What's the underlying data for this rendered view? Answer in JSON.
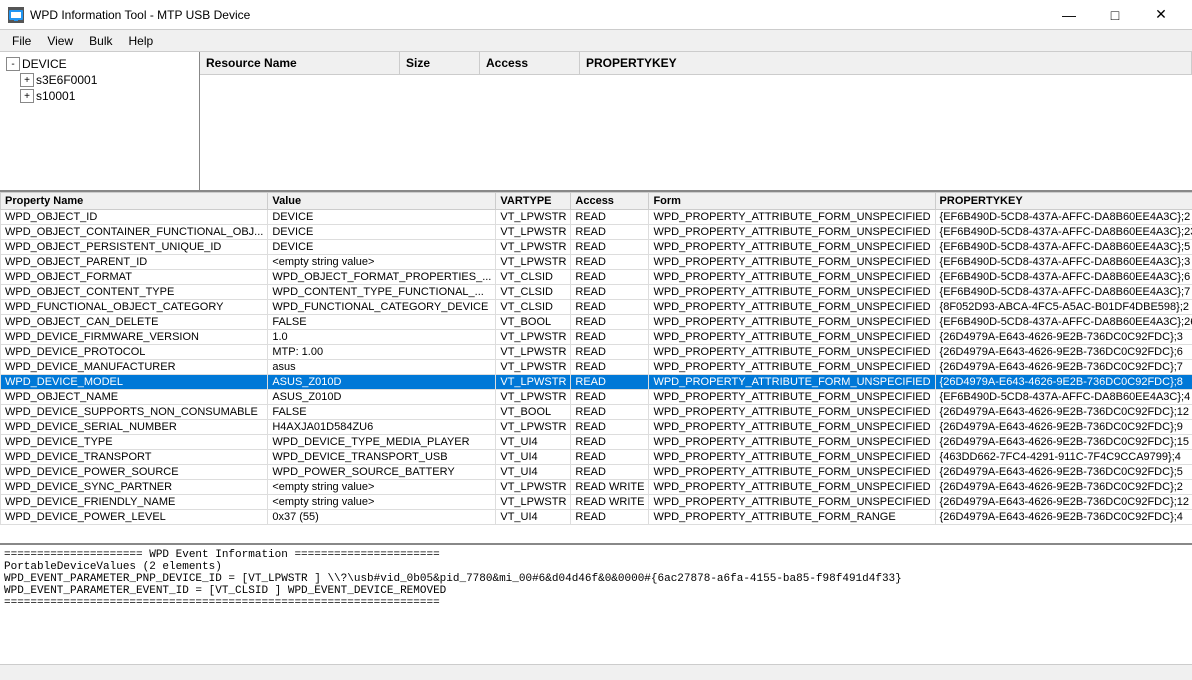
{
  "window": {
    "title": "WPD Information Tool - MTP USB Device",
    "icon": "device-icon"
  },
  "menu": {
    "items": [
      "File",
      "View",
      "Bulk",
      "Help"
    ]
  },
  "tree": {
    "root": "DEVICE",
    "children": [
      "s3E6F0001",
      "s10001"
    ]
  },
  "resource_table": {
    "headers": [
      "Resource Name",
      "Size",
      "Access",
      "PROPERTYKEY"
    ],
    "rows": []
  },
  "properties_table": {
    "headers": [
      "Property Name",
      "Value",
      "VARTYPE",
      "Access",
      "Form",
      "PROPERTYKEY"
    ],
    "selected_row": 12,
    "rows": [
      [
        "WPD_OBJECT_ID",
        "DEVICE",
        "VT_LPWSTR",
        "READ",
        "WPD_PROPERTY_ATTRIBUTE_FORM_UNSPECIFIED",
        "{EF6B490D-5CD8-437A-AFFC-DA8B60EE4A3C};2"
      ],
      [
        "WPD_OBJECT_CONTAINER_FUNCTIONAL_OBJ...",
        "DEVICE",
        "VT_LPWSTR",
        "READ",
        "WPD_PROPERTY_ATTRIBUTE_FORM_UNSPECIFIED",
        "{EF6B490D-5CD8-437A-AFFC-DA8B60EE4A3C};23"
      ],
      [
        "WPD_OBJECT_PERSISTENT_UNIQUE_ID",
        "DEVICE",
        "VT_LPWSTR",
        "READ",
        "WPD_PROPERTY_ATTRIBUTE_FORM_UNSPECIFIED",
        "{EF6B490D-5CD8-437A-AFFC-DA8B60EE4A3C};5"
      ],
      [
        "WPD_OBJECT_PARENT_ID",
        "<empty string value>",
        "VT_LPWSTR",
        "READ",
        "WPD_PROPERTY_ATTRIBUTE_FORM_UNSPECIFIED",
        "{EF6B490D-5CD8-437A-AFFC-DA8B60EE4A3C};3"
      ],
      [
        "WPD_OBJECT_FORMAT",
        "WPD_OBJECT_FORMAT_PROPERTIES_...",
        "VT_CLSID",
        "READ",
        "WPD_PROPERTY_ATTRIBUTE_FORM_UNSPECIFIED",
        "{EF6B490D-5CD8-437A-AFFC-DA8B60EE4A3C};6"
      ],
      [
        "WPD_OBJECT_CONTENT_TYPE",
        "WPD_CONTENT_TYPE_FUNCTIONAL_...",
        "VT_CLSID",
        "READ",
        "WPD_PROPERTY_ATTRIBUTE_FORM_UNSPECIFIED",
        "{EF6B490D-5CD8-437A-AFFC-DA8B60EE4A3C};7"
      ],
      [
        "WPD_FUNCTIONAL_OBJECT_CATEGORY",
        "WPD_FUNCTIONAL_CATEGORY_DEVICE",
        "VT_CLSID",
        "READ",
        "WPD_PROPERTY_ATTRIBUTE_FORM_UNSPECIFIED",
        "{8F052D93-ABCA-4FC5-A5AC-B01DF4DBE598};2"
      ],
      [
        "WPD_OBJECT_CAN_DELETE",
        "FALSE",
        "VT_BOOL",
        "READ",
        "WPD_PROPERTY_ATTRIBUTE_FORM_UNSPECIFIED",
        "{EF6B490D-5CD8-437A-AFFC-DA8B60EE4A3C};26"
      ],
      [
        "WPD_DEVICE_FIRMWARE_VERSION",
        "1.0",
        "VT_LPWSTR",
        "READ",
        "WPD_PROPERTY_ATTRIBUTE_FORM_UNSPECIFIED",
        "{26D4979A-E643-4626-9E2B-736DC0C92FDC};3"
      ],
      [
        "WPD_DEVICE_PROTOCOL",
        "MTP: 1.00",
        "VT_LPWSTR",
        "READ",
        "WPD_PROPERTY_ATTRIBUTE_FORM_UNSPECIFIED",
        "{26D4979A-E643-4626-9E2B-736DC0C92FDC};6"
      ],
      [
        "WPD_DEVICE_MANUFACTURER",
        "asus",
        "VT_LPWSTR",
        "READ",
        "WPD_PROPERTY_ATTRIBUTE_FORM_UNSPECIFIED",
        "{26D4979A-E643-4626-9E2B-736DC0C92FDC};7"
      ],
      [
        "WPD_DEVICE_MODEL",
        "ASUS_Z010D",
        "VT_LPWSTR",
        "READ",
        "WPD_PROPERTY_ATTRIBUTE_FORM_UNSPECIFIED",
        "{26D4979A-E643-4626-9E2B-736DC0C92FDC};8"
      ],
      [
        "WPD_OBJECT_NAME",
        "ASUS_Z010D",
        "VT_LPWSTR",
        "READ",
        "WPD_PROPERTY_ATTRIBUTE_FORM_UNSPECIFIED",
        "{EF6B490D-5CD8-437A-AFFC-DA8B60EE4A3C};4"
      ],
      [
        "WPD_DEVICE_SUPPORTS_NON_CONSUMABLE",
        "FALSE",
        "VT_BOOL",
        "READ",
        "WPD_PROPERTY_ATTRIBUTE_FORM_UNSPECIFIED",
        "{26D4979A-E643-4626-9E2B-736DC0C92FDC};12"
      ],
      [
        "WPD_DEVICE_SERIAL_NUMBER",
        "H4AXJA01D584ZU6",
        "VT_LPWSTR",
        "READ",
        "WPD_PROPERTY_ATTRIBUTE_FORM_UNSPECIFIED",
        "{26D4979A-E643-4626-9E2B-736DC0C92FDC};9"
      ],
      [
        "WPD_DEVICE_TYPE",
        "WPD_DEVICE_TYPE_MEDIA_PLAYER",
        "VT_UI4",
        "READ",
        "WPD_PROPERTY_ATTRIBUTE_FORM_UNSPECIFIED",
        "{26D4979A-E643-4626-9E2B-736DC0C92FDC};15"
      ],
      [
        "WPD_DEVICE_TRANSPORT",
        "WPD_DEVICE_TRANSPORT_USB",
        "VT_UI4",
        "READ",
        "WPD_PROPERTY_ATTRIBUTE_FORM_UNSPECIFIED",
        "{463DD662-7FC4-4291-911C-7F4C9CCA9799};4"
      ],
      [
        "WPD_DEVICE_POWER_SOURCE",
        "WPD_POWER_SOURCE_BATTERY",
        "VT_UI4",
        "READ",
        "WPD_PROPERTY_ATTRIBUTE_FORM_UNSPECIFIED",
        "{26D4979A-E643-4626-9E2B-736DC0C92FDC};5"
      ],
      [
        "WPD_DEVICE_SYNC_PARTNER",
        "<empty string value>",
        "VT_LPWSTR",
        "READ WRITE",
        "WPD_PROPERTY_ATTRIBUTE_FORM_UNSPECIFIED",
        "{26D4979A-E643-4626-9E2B-736DC0C92FDC};2"
      ],
      [
        "WPD_DEVICE_FRIENDLY_NAME",
        "<empty string value>",
        "VT_LPWSTR",
        "READ WRITE",
        "WPD_PROPERTY_ATTRIBUTE_FORM_UNSPECIFIED",
        "{26D4979A-E643-4626-9E2B-736DC0C92FDC};12"
      ],
      [
        "WPD_DEVICE_POWER_LEVEL",
        "0x37 (55)",
        "VT_UI4",
        "READ",
        "WPD_PROPERTY_ATTRIBUTE_FORM_RANGE",
        "{26D4979A-E643-4626-9E2B-736DC0C92FDC};4"
      ]
    ]
  },
  "log": {
    "lines": [
      "===================== WPD Event Information ======================",
      "PortableDeviceValues (2 elements)",
      "WPD_EVENT_PARAMETER_PNP_DEVICE_ID          = [VT_LPWSTR   ] \\\\?\\usb#vid_0b05&pid_7780&mi_00#6&d04d46f&0&0000#{6ac27878-a6fa-4155-ba85-f98f491d4f33}",
      "WPD_EVENT_PARAMETER_EVENT_ID               = [VT_CLSID    ] WPD_EVENT_DEVICE_REMOVED",
      "=================================================================="
    ]
  },
  "titlebar_controls": {
    "minimize": "—",
    "maximize": "□",
    "close": "✕"
  }
}
